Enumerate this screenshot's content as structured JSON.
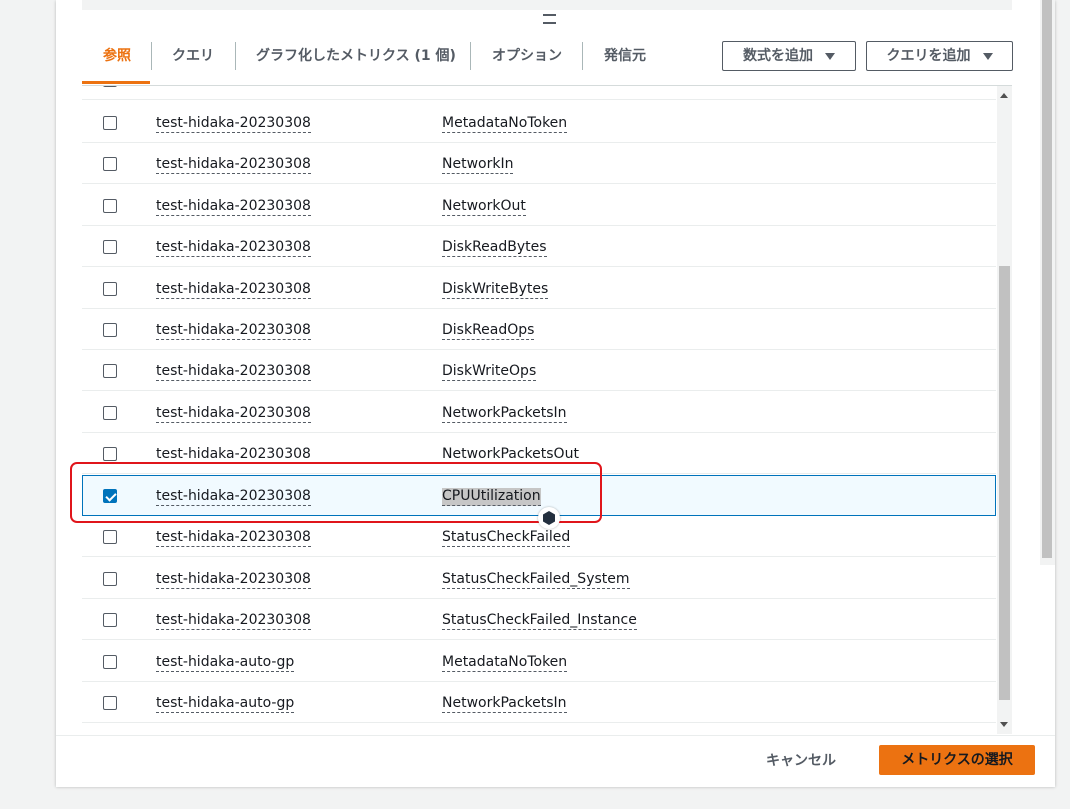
{
  "tabs": [
    {
      "label": "参照",
      "active": true
    },
    {
      "label": "クエリ",
      "active": false
    },
    {
      "label": "グラフ化したメトリクス (1 個)",
      "active": false
    },
    {
      "label": "オプション",
      "active": false
    },
    {
      "label": "発信元",
      "active": false
    }
  ],
  "header_buttons": {
    "add_math": "数式を追加",
    "add_query": "クエリを追加"
  },
  "rows": [
    {
      "instance": "test-hidaka-20230308",
      "metric": "MetadataNoToken",
      "checked": false
    },
    {
      "instance": "test-hidaka-20230308",
      "metric": "NetworkIn",
      "checked": false
    },
    {
      "instance": "test-hidaka-20230308",
      "metric": "NetworkOut",
      "checked": false
    },
    {
      "instance": "test-hidaka-20230308",
      "metric": "DiskReadBytes",
      "checked": false
    },
    {
      "instance": "test-hidaka-20230308",
      "metric": "DiskWriteBytes",
      "checked": false
    },
    {
      "instance": "test-hidaka-20230308",
      "metric": "DiskReadOps",
      "checked": false
    },
    {
      "instance": "test-hidaka-20230308",
      "metric": "DiskWriteOps",
      "checked": false
    },
    {
      "instance": "test-hidaka-20230308",
      "metric": "NetworkPacketsIn",
      "checked": false
    },
    {
      "instance": "test-hidaka-20230308",
      "metric": "NetworkPacketsOut",
      "checked": false
    },
    {
      "instance": "test-hidaka-20230308",
      "metric": "CPUUtilization",
      "checked": true
    },
    {
      "instance": "test-hidaka-20230308",
      "metric": "StatusCheckFailed",
      "checked": false
    },
    {
      "instance": "test-hidaka-20230308",
      "metric": "StatusCheckFailed_System",
      "checked": false
    },
    {
      "instance": "test-hidaka-20230308",
      "metric": "StatusCheckFailed_Instance",
      "checked": false
    },
    {
      "instance": "test-hidaka-auto-gp",
      "metric": "MetadataNoToken",
      "checked": false
    },
    {
      "instance": "test-hidaka-auto-gp",
      "metric": "NetworkPacketsIn",
      "checked": false
    }
  ],
  "footer": {
    "cancel": "キャンセル",
    "select": "メトリクスの選択"
  },
  "colors": {
    "accent": "#ec7211",
    "selection_border": "#0073bb",
    "annotation": "#e0151b"
  }
}
